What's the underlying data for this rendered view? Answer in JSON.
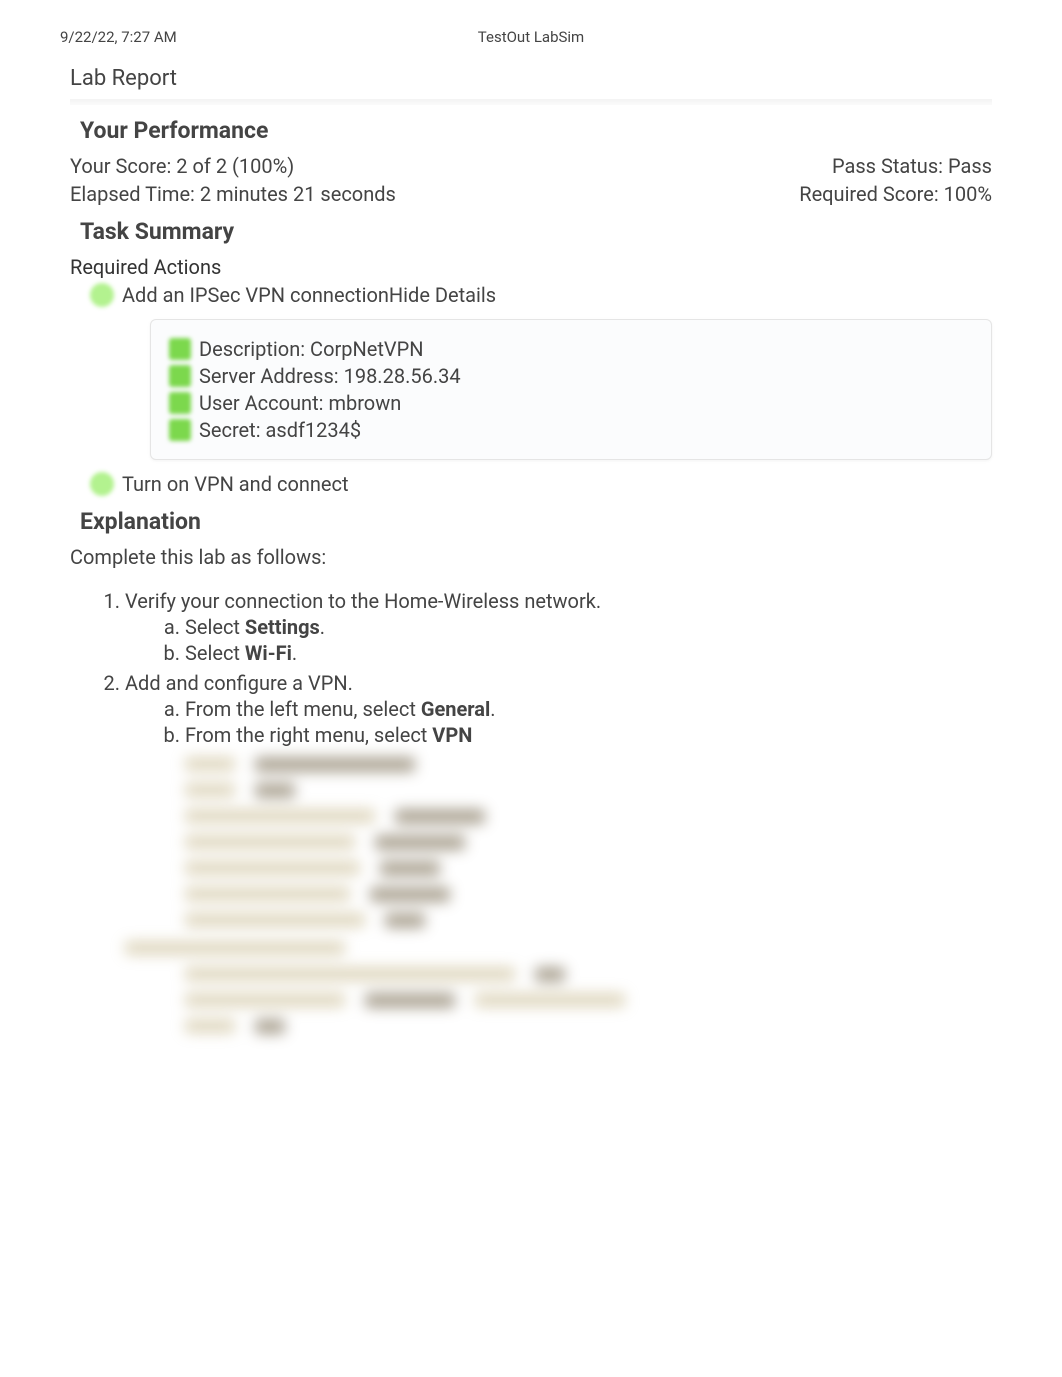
{
  "header": {
    "date": "9/22/22, 7:27 AM",
    "app_name": "TestOut LabSim"
  },
  "report": {
    "title": "Lab Report",
    "performance_heading": "Your Performance",
    "score_line": "Your Score: 2 of 2 (100%)",
    "pass_status": "Pass Status: Pass",
    "elapsed_time": "Elapsed Time: 2 minutes 21 seconds",
    "required_score": "Required Score: 100%",
    "task_summary_heading": "Task Summary",
    "required_actions_label": "Required Actions",
    "action1": {
      "label": "Add an IPSec VPN connection",
      "toggle": "Hide Details",
      "details": [
        "Description: CorpNetVPN",
        "Server Address: 198.28.56.34",
        "User Account: mbrown",
        "Secret: asdf1234$"
      ]
    },
    "action2": {
      "label": "Turn on VPN and connect"
    },
    "explanation_heading": "Explanation",
    "explanation_intro": "Complete this lab as follows:",
    "steps": [
      {
        "text": "Verify your connection to the Home-Wireless network.",
        "substeps": [
          {
            "pre": "Select ",
            "bold": "Settings",
            "post": "."
          },
          {
            "pre": "Select ",
            "bold": "Wi-Fi",
            "post": "."
          }
        ]
      },
      {
        "text": "Add and configure a VPN.",
        "substeps": [
          {
            "pre": "From the left menu, select ",
            "bold": "General",
            "post": "."
          },
          {
            "pre": "From the right menu, select ",
            "bold": "VPN",
            "post": ""
          }
        ]
      }
    ]
  }
}
